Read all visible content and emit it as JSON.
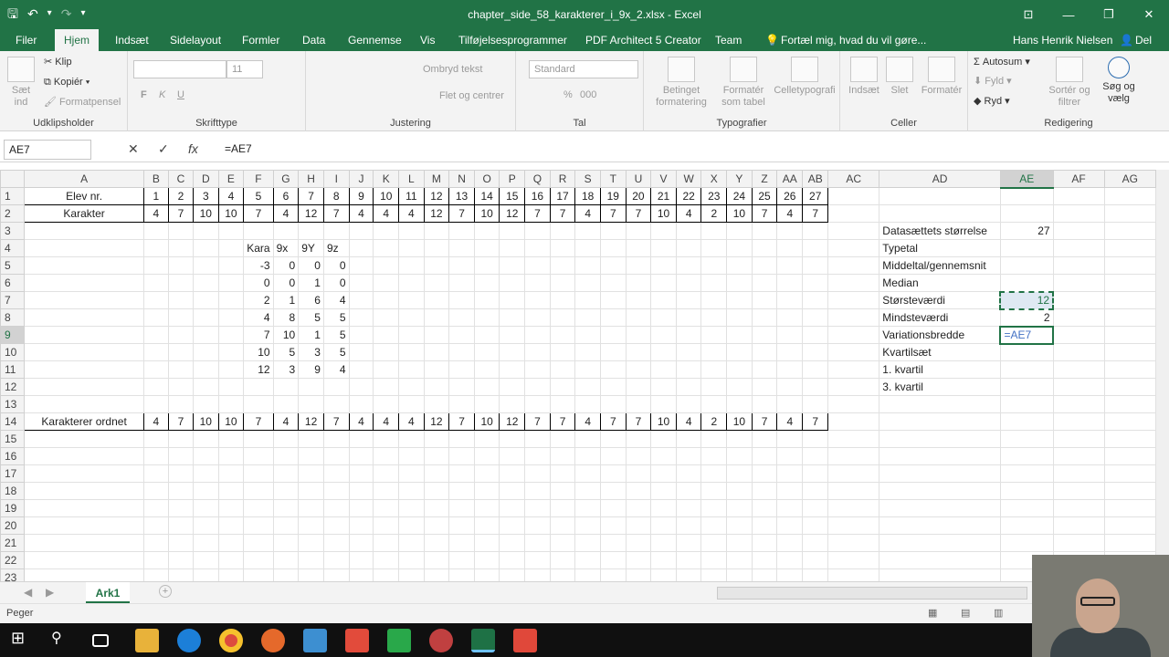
{
  "window": {
    "title": "chapter_side_58_karakterer_i_9x_2.xlsx - Excel",
    "buttons": [
      "⊡",
      "—",
      "❐",
      "✕"
    ]
  },
  "qat": {
    "save": "🖫",
    "undo": "↶",
    "undo_menu": "▾",
    "redo": "↷",
    "customize": "▾"
  },
  "menu": {
    "tabs": [
      "Filer",
      "Hjem",
      "Indsæt",
      "Sidelayout",
      "Formler",
      "Data",
      "Gennemse",
      "Vis",
      "Tilføjelsesprogrammer",
      "PDF Architect 5 Creator",
      "Team"
    ],
    "tellme": "Fortæl mig, hvad du vil gøre...",
    "user": "Hans Henrik Nielsen",
    "share": "Del"
  },
  "ribbon": {
    "clipboard": {
      "paste": "Sæt ind",
      "cut": "Klip",
      "copy": "Kopiér",
      "format_painter": "Formatpensel",
      "label": "Udklipsholder"
    },
    "font": {
      "size": "11",
      "bold": "F",
      "italic": "K",
      "underline": "U",
      "label": "Skrifttype"
    },
    "alignment": {
      "wrap": "Ombryd tekst",
      "merge": "Flet og centrer",
      "label": "Justering"
    },
    "number": {
      "format": "Standard",
      "percent": "%",
      "thousands": "000",
      "label": "Tal"
    },
    "styles": {
      "conditional": "Betinget formatering",
      "table": "Formatér som tabel",
      "cell": "Celletypografi",
      "label": "Typografier"
    },
    "cells": {
      "insert": "Indsæt",
      "delete": "Slet",
      "format": "Formatér",
      "label": "Celler"
    },
    "editing": {
      "autosum": "Autosum",
      "fill": "Fyld",
      "clear": "Ryd",
      "sort": "Sortér og filtrer",
      "find": "Søg og vælg",
      "label": "Redigering"
    }
  },
  "formula": {
    "namebox": "AE7",
    "cancel": "✕",
    "enter": "✓",
    "fx": "fx",
    "content": "=AE7"
  },
  "columns": [
    "A",
    "B",
    "C",
    "D",
    "E",
    "F",
    "G",
    "H",
    "I",
    "J",
    "K",
    "L",
    "M",
    "N",
    "O",
    "P",
    "Q",
    "R",
    "S",
    "T",
    "U",
    "V",
    "W",
    "X",
    "Y",
    "Z",
    "AA",
    "AB",
    "AC",
    "AD",
    "AE",
    "AF",
    "AG"
  ],
  "rows": [
    {
      "n": "1",
      "A": "Elev nr.",
      "B": "1",
      "C": "2",
      "D": "3",
      "E": "4",
      "F": "5",
      "G": "6",
      "H": "7",
      "I": "8",
      "J": "9",
      "K": "10",
      "L": "11",
      "M": "12",
      "N": "13",
      "O": "14",
      "P": "15",
      "Q": "16",
      "R": "17",
      "S": "18",
      "T": "19",
      "U": "20",
      "V": "21",
      "W": "22",
      "X": "23",
      "Y": "24",
      "Z": "25",
      "AA": "26",
      "AB": "27"
    },
    {
      "n": "2",
      "A": "Karakter",
      "B": "4",
      "C": "7",
      "D": "10",
      "E": "10",
      "F": "7",
      "G": "4",
      "H": "12",
      "I": "7",
      "J": "4",
      "K": "4",
      "L": "4",
      "M": "12",
      "N": "7",
      "O": "10",
      "P": "12",
      "Q": "7",
      "R": "7",
      "S": "4",
      "T": "7",
      "U": "7",
      "V": "10",
      "W": "4",
      "X": "2",
      "Y": "10",
      "Z": "7",
      "AA": "4",
      "AB": "7"
    },
    {
      "n": "3",
      "AD": "Datasættets størrelse",
      "AE": "27"
    },
    {
      "n": "4",
      "F": "Kara",
      "G": "9x",
      "H": "9Y",
      "I": "9z",
      "AD": "Typetal"
    },
    {
      "n": "5",
      "F": "-3",
      "G": "0",
      "H": "0",
      "I": "0",
      "AD": "Middeltal/gennemsnit"
    },
    {
      "n": "6",
      "F": "0",
      "G": "0",
      "H": "1",
      "I": "0",
      "AD": "Median"
    },
    {
      "n": "7",
      "F": "2",
      "G": "1",
      "H": "6",
      "I": "4",
      "AD": "Størsteværdi",
      "AE": "12"
    },
    {
      "n": "8",
      "F": "4",
      "G": "8",
      "H": "5",
      "I": "5",
      "AD": "Mindsteværdi",
      "AE": "2"
    },
    {
      "n": "9",
      "F": "7",
      "G": "10",
      "H": "1",
      "I": "5",
      "AD": "Variationsbredde",
      "AE": "=AE7"
    },
    {
      "n": "10",
      "F": "10",
      "G": "5",
      "H": "3",
      "I": "5",
      "AD": "Kvartilsæt"
    },
    {
      "n": "11",
      "F": "12",
      "G": "3",
      "H": "9",
      "I": "4",
      "AD": "1. kvartil"
    },
    {
      "n": "12",
      "AD": "3. kvartil"
    },
    {
      "n": "13"
    },
    {
      "n": "14",
      "A": "Karakterer ordnet",
      "B": "4",
      "C": "7",
      "D": "10",
      "E": "10",
      "F": "7",
      "G": "4",
      "H": "12",
      "I": "7",
      "J": "4",
      "K": "4",
      "L": "4",
      "M": "12",
      "N": "7",
      "O": "10",
      "P": "12",
      "Q": "7",
      "R": "7",
      "S": "4",
      "T": "7",
      "U": "7",
      "V": "10",
      "W": "4",
      "X": "2",
      "Y": "10",
      "Z": "7",
      "AA": "4",
      "AB": "7"
    },
    {
      "n": "15"
    },
    {
      "n": "16"
    },
    {
      "n": "17"
    },
    {
      "n": "18"
    },
    {
      "n": "19"
    },
    {
      "n": "20"
    },
    {
      "n": "21"
    },
    {
      "n": "22"
    },
    {
      "n": "23"
    }
  ],
  "sheet": {
    "tab": "Ark1",
    "add": "+"
  },
  "status": {
    "mode": "Peger"
  },
  "colors": {
    "accent": "#217346",
    "selection": "#217346",
    "ref_blue": "#4472c4"
  }
}
